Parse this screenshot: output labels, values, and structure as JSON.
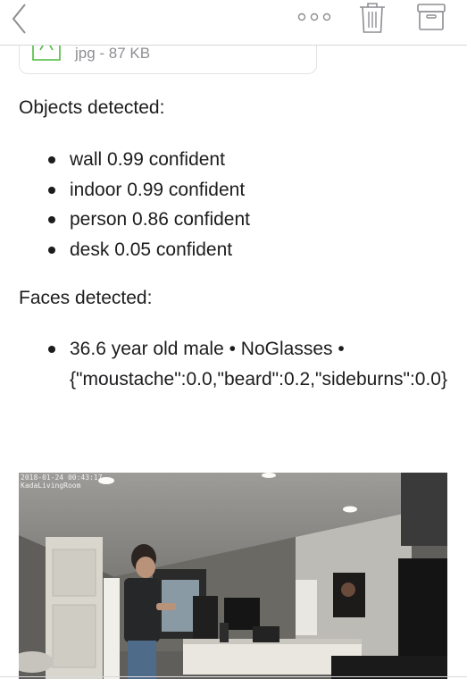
{
  "toolbar": {
    "back_icon": "chevron-left-icon",
    "more_icon": "more-dots-icon",
    "trash_icon": "trash-icon",
    "archive_icon": "archive-icon",
    "icon_color": "#8e8e93"
  },
  "attachment": {
    "icon": "image-file-icon",
    "meta": "jpg - 87 KB",
    "icon_color": "#4cbb3b"
  },
  "objects": {
    "title": "Objects detected:",
    "items": [
      "wall 0.99 confident",
      "indoor 0.99 confident",
      "person 0.86 confident",
      "desk 0.05 confident"
    ]
  },
  "faces": {
    "title": "Faces detected:",
    "items": [
      "36.6 year old male • NoGlasses • {\"moustache\":0.0,\"beard\":0.2,\"sideburns\":0.0}"
    ]
  },
  "photo": {
    "timestamp": "2018-01-24 00:43:17",
    "camera_label": "KadaLivingRoom"
  }
}
